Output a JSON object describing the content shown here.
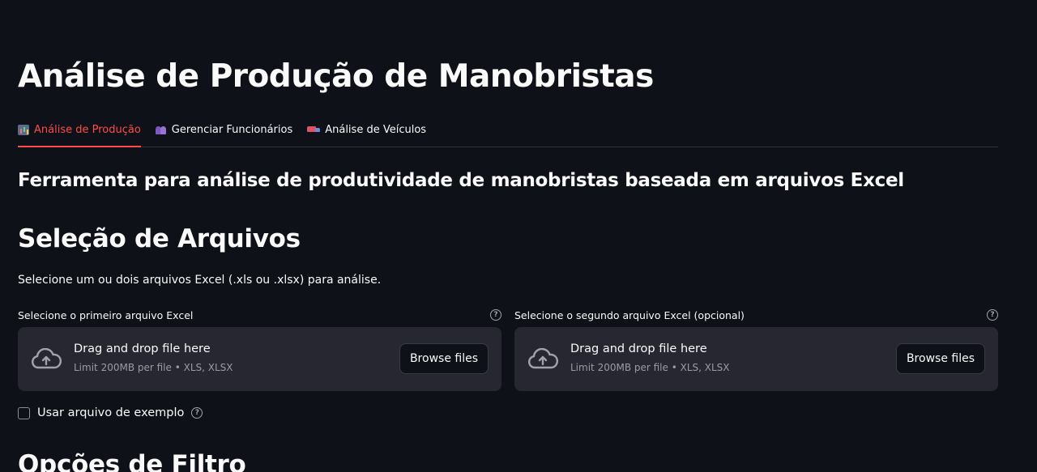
{
  "page": {
    "title": "Análise de Produção de Manobristas",
    "subtitle": "Ferramenta para análise de produtividade de manobristas baseada em arquivos Excel"
  },
  "tabs": [
    {
      "label": "Análise de Produção",
      "icon": "bar-chart-icon",
      "active": true
    },
    {
      "label": "Gerenciar Funcionários",
      "icon": "people-icon",
      "active": false
    },
    {
      "label": "Análise de Veículos",
      "icon": "truck-icon",
      "active": false
    }
  ],
  "file_selection": {
    "heading": "Seleção de Arquivos",
    "description": "Selecione um ou dois arquivos Excel (.xls ou .xlsx) para análise.",
    "uploaders": [
      {
        "label": "Selecione o primeiro arquivo Excel",
        "drop_text": "Drag and drop file here",
        "limit_text": "Limit 200MB per file • XLS, XLSX",
        "button_label": "Browse files"
      },
      {
        "label": "Selecione o segundo arquivo Excel (opcional)",
        "drop_text": "Drag and drop file here",
        "limit_text": "Limit 200MB per file • XLS, XLSX",
        "button_label": "Browse files"
      }
    ],
    "example_checkbox": {
      "label": "Usar arquivo de exemplo",
      "checked": false
    }
  },
  "filter_options": {
    "heading": "Opções de Filtro"
  },
  "colors": {
    "background": "#0e1117",
    "accent": "#ff4b4b",
    "panel": "#262730",
    "text": "#fafafa"
  }
}
